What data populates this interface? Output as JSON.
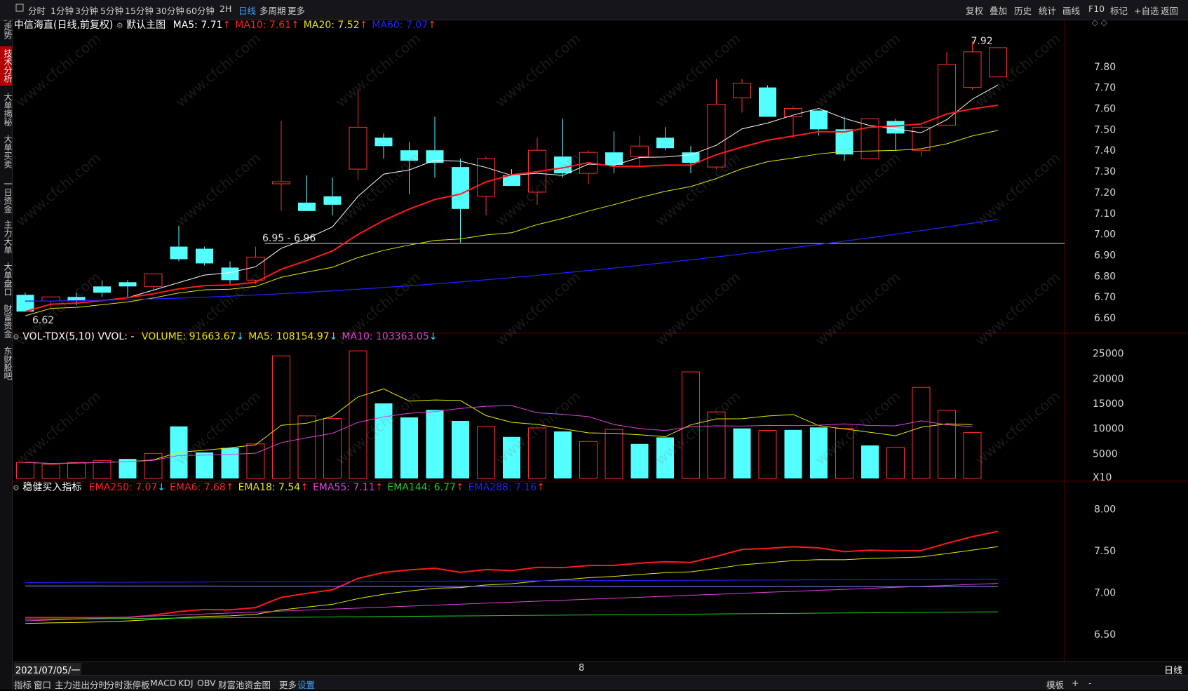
{
  "toolbar": {
    "left_items": [
      "分时",
      "1分钟",
      "3分钟",
      "5分钟",
      "15分钟",
      "30分钟",
      "60分钟",
      "2H",
      "日线",
      "多周期",
      "更多"
    ],
    "active": "日线",
    "right_items": [
      "复权",
      "叠加",
      "历史",
      "统计",
      "画线",
      "F10",
      "标记",
      "+自选",
      "返回"
    ]
  },
  "left_tabs": [
    "分时走势",
    "技术分析",
    "大单揭秘",
    "大单买卖",
    "一日资金",
    "主力大单",
    "大单盘口",
    "财富资金",
    "东财股吧"
  ],
  "left_tab_active": "技术分析",
  "main_panel": {
    "title": "中信海直(日线,前复权)",
    "main_label": "默认主图",
    "indicators": [
      {
        "label": "MA5: 7.71",
        "arrow": "↑",
        "color": "#ffffff"
      },
      {
        "label": "MA10: 7.61",
        "arrow": "↑",
        "color": "#ff2020"
      },
      {
        "label": "MA20: 7.52",
        "arrow": "↑",
        "color": "#e8e800"
      },
      {
        "label": "MA60: 7.07",
        "arrow": "↑",
        "color": "#2020ff"
      }
    ],
    "high_marker": "7.92",
    "low_marker": "6.62",
    "hline_label": "6.95 - 6.96",
    "y_labels": [
      "7.80",
      "7.70",
      "7.60",
      "7.50",
      "7.40",
      "7.30",
      "7.20",
      "7.10",
      "7.00",
      "6.90",
      "6.80",
      "6.70",
      "6.60"
    ]
  },
  "volume_panel": {
    "label": "VOL-TDX(5,10) VVOL: -",
    "indicators": [
      {
        "label": "VOLUME: 91663.67",
        "arrow": "↓",
        "color": "#e8e800"
      },
      {
        "label": "MA5: 108154.97",
        "arrow": "↓",
        "color": "#e8e800"
      },
      {
        "label": "MA10: 103363.05",
        "arrow": "↓",
        "color": "#e040e0"
      }
    ],
    "y_labels": [
      "25000",
      "20000",
      "15000",
      "10000",
      "5000",
      "X10"
    ]
  },
  "indicator_panel": {
    "label": "稳健买入指标",
    "indicators": [
      {
        "label": "EMA250: 7.07",
        "arrow": "↓",
        "color": "#ff2020"
      },
      {
        "label": "EMA6: 7.68",
        "arrow": "↑",
        "color": "#ff2020"
      },
      {
        "label": "EMA18: 7.54",
        "arrow": "↑",
        "color": "#e8e800"
      },
      {
        "label": "EMA55: 7.11",
        "arrow": "↑",
        "color": "#e040e0"
      },
      {
        "label": "EMA144: 6.77",
        "arrow": "↑",
        "color": "#20d020"
      },
      {
        "label": "EMA288: 7.16",
        "arrow": "↑",
        "color": "#2020ff"
      }
    ],
    "y_labels": [
      "8.00",
      "7.50",
      "7.00",
      "6.50"
    ]
  },
  "date_bar": {
    "date": "2021/07/05/一",
    "mid": "8",
    "period": "日线"
  },
  "bottom_tabs": [
    "指标",
    "窗口",
    "主力进出分时",
    "分时涨停板",
    "MACD",
    "KDJ",
    "OBV",
    "财富池资金图",
    "更多",
    "设置"
  ],
  "bottom_active": "设置",
  "bottom_right": [
    "模板",
    "+",
    "-"
  ],
  "watermark": "www.cfchi.com",
  "chart_data": {
    "type": "candlestick",
    "ylim": [
      6.55,
      7.95
    ],
    "candles": [
      {
        "o": 6.71,
        "h": 6.72,
        "l": 6.63,
        "c": 6.63
      },
      {
        "o": 6.68,
        "h": 6.7,
        "l": 6.65,
        "c": 6.7
      },
      {
        "o": 6.7,
        "h": 6.72,
        "l": 6.66,
        "c": 6.68
      },
      {
        "o": 6.75,
        "h": 6.78,
        "l": 6.7,
        "c": 6.72
      },
      {
        "o": 6.77,
        "h": 6.78,
        "l": 6.7,
        "c": 6.75
      },
      {
        "o": 6.75,
        "h": 6.81,
        "l": 6.73,
        "c": 6.81
      },
      {
        "o": 6.94,
        "h": 7.04,
        "l": 6.87,
        "c": 6.88
      },
      {
        "o": 6.93,
        "h": 6.94,
        "l": 6.85,
        "c": 6.86
      },
      {
        "o": 6.84,
        "h": 6.87,
        "l": 6.76,
        "c": 6.78
      },
      {
        "o": 6.78,
        "h": 6.94,
        "l": 6.76,
        "c": 6.89
      },
      {
        "o": 7.24,
        "h": 7.54,
        "l": 7.11,
        "c": 7.25
      },
      {
        "o": 7.15,
        "h": 7.28,
        "l": 7.13,
        "c": 7.11
      },
      {
        "o": 7.18,
        "h": 7.27,
        "l": 7.09,
        "c": 7.14
      },
      {
        "o": 7.31,
        "h": 7.69,
        "l": 7.26,
        "c": 7.51
      },
      {
        "o": 7.46,
        "h": 7.48,
        "l": 7.36,
        "c": 7.42
      },
      {
        "o": 7.4,
        "h": 7.44,
        "l": 7.19,
        "c": 7.35
      },
      {
        "o": 7.4,
        "h": 7.56,
        "l": 7.27,
        "c": 7.34
      },
      {
        "o": 7.32,
        "h": 7.36,
        "l": 6.96,
        "c": 7.12
      },
      {
        "o": 7.18,
        "h": 7.37,
        "l": 7.09,
        "c": 7.36
      },
      {
        "o": 7.28,
        "h": 7.31,
        "l": 7.24,
        "c": 7.23
      },
      {
        "o": 7.2,
        "h": 7.46,
        "l": 7.14,
        "c": 7.4
      },
      {
        "o": 7.37,
        "h": 7.55,
        "l": 7.27,
        "c": 7.29
      },
      {
        "o": 7.29,
        "h": 7.4,
        "l": 7.24,
        "c": 7.39
      },
      {
        "o": 7.39,
        "h": 7.49,
        "l": 7.29,
        "c": 7.33
      },
      {
        "o": 7.37,
        "h": 7.47,
        "l": 7.32,
        "c": 7.42
      },
      {
        "o": 7.46,
        "h": 7.51,
        "l": 7.4,
        "c": 7.41
      },
      {
        "o": 7.39,
        "h": 7.42,
        "l": 7.29,
        "c": 7.34
      },
      {
        "o": 7.32,
        "h": 7.74,
        "l": 7.31,
        "c": 7.62
      },
      {
        "o": 7.65,
        "h": 7.74,
        "l": 7.58,
        "c": 7.72
      },
      {
        "o": 7.7,
        "h": 7.71,
        "l": 7.56,
        "c": 7.56
      },
      {
        "o": 7.56,
        "h": 7.61,
        "l": 7.46,
        "c": 7.6
      },
      {
        "o": 7.59,
        "h": 7.59,
        "l": 7.47,
        "c": 7.5
      },
      {
        "o": 7.5,
        "h": 7.56,
        "l": 7.35,
        "c": 7.38
      },
      {
        "o": 7.36,
        "h": 7.55,
        "l": 7.36,
        "c": 7.55
      },
      {
        "o": 7.54,
        "h": 7.55,
        "l": 7.4,
        "c": 7.48
      },
      {
        "o": 7.4,
        "h": 7.52,
        "l": 7.37,
        "c": 7.51
      },
      {
        "o": 7.52,
        "h": 7.87,
        "l": 7.52,
        "c": 7.81
      },
      {
        "o": 7.7,
        "h": 7.92,
        "l": 7.69,
        "c": 7.87
      },
      {
        "o": 7.75,
        "h": 7.89,
        "l": 7.75,
        "c": 7.89
      }
    ],
    "volume": [
      3.2,
      2.8,
      3.2,
      3.6,
      3.9,
      5.0,
      10.4,
      5.2,
      6.1,
      6.9,
      24.5,
      12.5,
      12.0,
      25.5,
      15.0,
      12.2,
      13.7,
      11.5,
      10.4,
      8.3,
      10.1,
      9.4,
      7.4,
      9.8,
      6.9,
      8.2,
      21.3,
      13.3,
      10.0,
      9.6,
      9.7,
      10.2,
      10.0,
      6.6,
      6.2,
      18.2,
      13.6,
      9.2
    ],
    "volume_up": [
      true,
      true,
      true,
      true,
      false,
      true,
      false,
      false,
      false,
      true,
      true,
      true,
      true,
      true,
      false,
      false,
      false,
      false,
      true,
      false,
      true,
      false,
      true,
      true,
      false,
      false,
      true,
      true,
      false,
      true,
      false,
      false,
      true,
      false,
      true,
      true,
      true,
      true
    ]
  }
}
